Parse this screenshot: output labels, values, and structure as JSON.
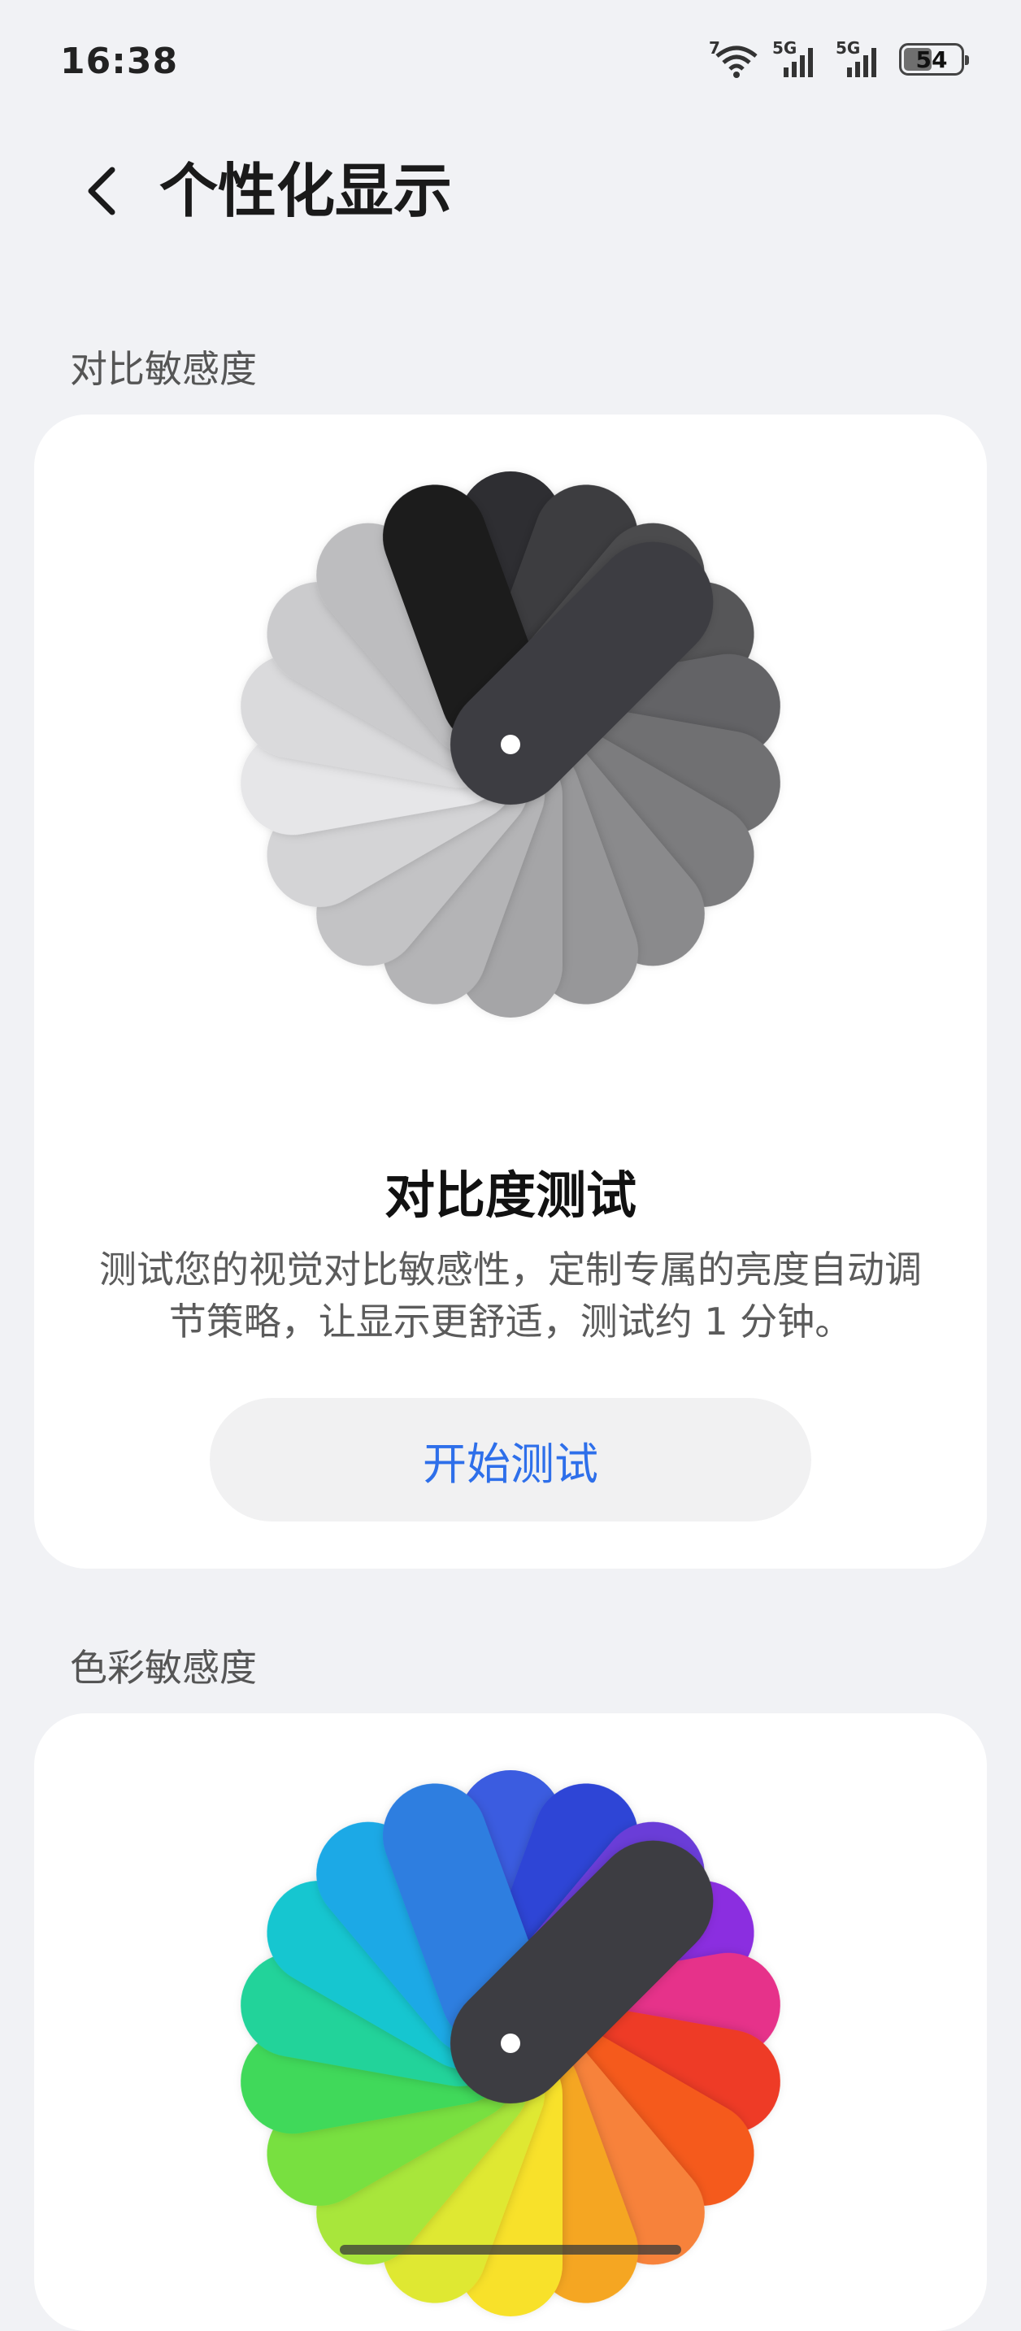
{
  "status_bar": {
    "time": "16:38",
    "wifi_badge": "7",
    "signal_1_label": "5G",
    "signal_2_label": "5G",
    "battery_percent": "54",
    "battery_level": 0.54
  },
  "header": {
    "title": "个性化显示",
    "back_icon": "chevron-left-icon"
  },
  "contrast_section": {
    "label": "对比敏感度",
    "swatch_colors": [
      "#2f2f33",
      "#3e3e41",
      "#4b4b4e",
      "#575759",
      "#636366",
      "#707072",
      "#7c7c7e",
      "#8a8a8c",
      "#979799",
      "#a5a5a7",
      "#b4b4b6",
      "#c3c3c5",
      "#d4d4d6",
      "#e6e6e8",
      "#dadadc",
      "#cbcbcd",
      "#bdbdbf",
      "#1b1b1d"
    ],
    "top_swatch_color": "#3e3e42",
    "test_title": "对比度测试",
    "test_description": "测试您的视觉对比敏感性，定制专属的亮度自动调节策略，让显示更舒适，测试约 1 分钟。",
    "start_button": "开始测试"
  },
  "color_section": {
    "label": "色彩敏感度",
    "swatch_colors": [
      "#3a5ce0",
      "#2f45d6",
      "#6a3ed8",
      "#8b2fe0",
      "#e6338a",
      "#ee3a26",
      "#f55a1e",
      "#f7823a",
      "#f5a623",
      "#f8e12a",
      "#dfe832",
      "#a8e63a",
      "#78e040",
      "#3fd95a",
      "#23d39a",
      "#18c6d0",
      "#1aa9e6",
      "#2f7ee0"
    ],
    "top_swatch_color": "#3e3e42"
  }
}
